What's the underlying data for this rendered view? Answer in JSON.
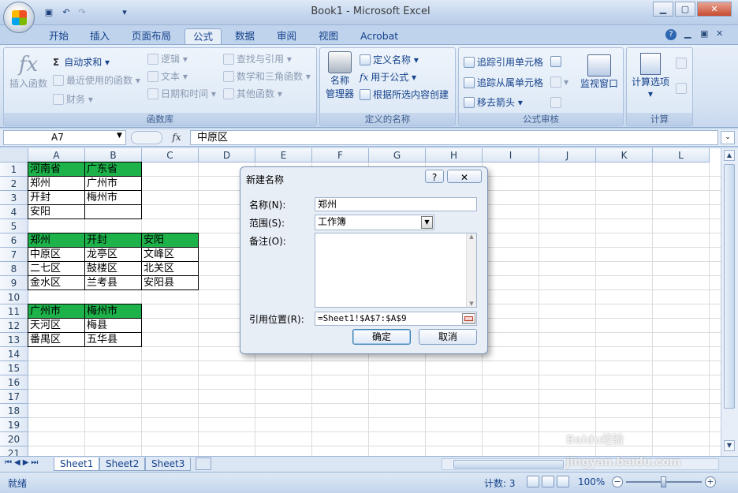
{
  "window": {
    "title": "Book1 - Microsoft Excel"
  },
  "tabs": [
    "开始",
    "插入",
    "页面布局",
    "公式",
    "数据",
    "审阅",
    "视图",
    "Acrobat"
  ],
  "active_tab": "公式",
  "ribbon": {
    "function_library": {
      "label": "函数库",
      "insert_function": "插入函数",
      "autosum": "自动求和",
      "recent": "最近使用的函数",
      "financial": "财务",
      "logical": "逻辑",
      "text": "文本",
      "datetime": "日期和时间",
      "lookup": "查找与引用",
      "math": "数学和三角函数",
      "other": "其他函数"
    },
    "defined_names": {
      "label": "定义的名称",
      "name_manager_l1": "名称",
      "name_manager_l2": "管理器",
      "define_name": "定义名称",
      "use_in_formula": "用于公式",
      "create_from_selection": "根据所选内容创建"
    },
    "formula_auditing": {
      "label": "公式审核",
      "trace_precedents": "追踪引用单元格",
      "trace_dependents": "追踪从属单元格",
      "remove_arrows": "移去箭头",
      "watch_window": "监视窗口"
    },
    "calculation": {
      "label": "计算",
      "calc_options": "计算选项"
    }
  },
  "formula_bar": {
    "name_box": "A7",
    "fx": "fx",
    "content": "中原区"
  },
  "columns": [
    "A",
    "B",
    "C",
    "D",
    "E",
    "F",
    "G",
    "H",
    "I",
    "J",
    "K",
    "L"
  ],
  "rows": [
    "1",
    "2",
    "3",
    "4",
    "5",
    "6",
    "7",
    "8",
    "9",
    "10",
    "11",
    "12",
    "13",
    "14",
    "15",
    "16",
    "17",
    "18",
    "19",
    "20",
    "21"
  ],
  "cells": {
    "A1": "河南省",
    "B1": "广东省",
    "A2": "郑州",
    "B2": "广州市",
    "A3": "开封",
    "B3": "梅州市",
    "A4": "安阳",
    "B4": "",
    "A6": "郑州",
    "B6": "开封",
    "C6": "安阳",
    "A7": "中原区",
    "B7": "龙亭区",
    "C7": "文峰区",
    "A8": "二七区",
    "B8": "鼓楼区",
    "C8": "北关区",
    "A9": "金水区",
    "B9": "兰考县",
    "C9": "安阳县",
    "A11": "广州市",
    "B11": "梅州市",
    "A12": "天河区",
    "B12": "梅县",
    "A13": "番禺区",
    "B13": "五华县"
  },
  "colors": {
    "header_fill": "#1db24a"
  },
  "sheet_tabs": [
    "Sheet1",
    "Sheet2",
    "Sheet3"
  ],
  "status": {
    "ready": "就绪",
    "count": "计数: 3",
    "zoom": "100%"
  },
  "dialog": {
    "title": "新建名称",
    "name_label": "名称(N):",
    "name_value": "郑州",
    "scope_label": "范围(S):",
    "scope_value": "工作簿",
    "comment_label": "备注(O):",
    "ref_label": "引用位置(R):",
    "ref_value": "=Sheet1!$A$7:$A$9",
    "ok": "确定",
    "cancel": "取消",
    "help": "?",
    "close": "✕"
  },
  "watermark": "Baidu经验 jingyan.baidu.com"
}
